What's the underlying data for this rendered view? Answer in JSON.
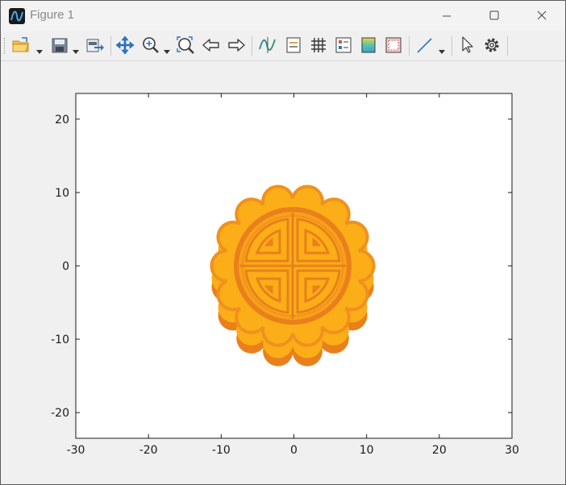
{
  "window": {
    "title": "Figure 1"
  },
  "titlebar": {
    "minimize_icon": "minimize-icon",
    "maximize_icon": "maximize-icon",
    "close_icon": "close-icon"
  },
  "toolbar": {
    "items": [
      "open-file-icon",
      "save-icon",
      "export-icon",
      "pan-icon",
      "zoom-in-icon",
      "zoom-fit-icon",
      "back-arrow-icon",
      "forward-arrow-icon",
      "data-cursor-icon",
      "legend-icon",
      "grid-icon",
      "colorbar-icon",
      "colormap-icon",
      "box-icon",
      "line-style-icon",
      "select-pointer-icon",
      "settings-gear-icon"
    ]
  },
  "plot": {
    "xaxis": {
      "ticks": [
        "-30",
        "-20",
        "-10",
        "0",
        "10",
        "20",
        "30"
      ],
      "values": [
        -30,
        -20,
        -10,
        0,
        10,
        20,
        30
      ],
      "range": [
        -30,
        30
      ]
    },
    "yaxis": {
      "ticks": [
        "-20",
        "-10",
        "0",
        "10",
        "20"
      ],
      "values": [
        -20,
        -10,
        0,
        10,
        20
      ],
      "range": [
        -23.5,
        23.5
      ]
    },
    "image": {
      "subject": "mooncake",
      "colors": {
        "top": "#fbae17",
        "side": "#e9801b",
        "outline": "#f0911e"
      }
    }
  }
}
